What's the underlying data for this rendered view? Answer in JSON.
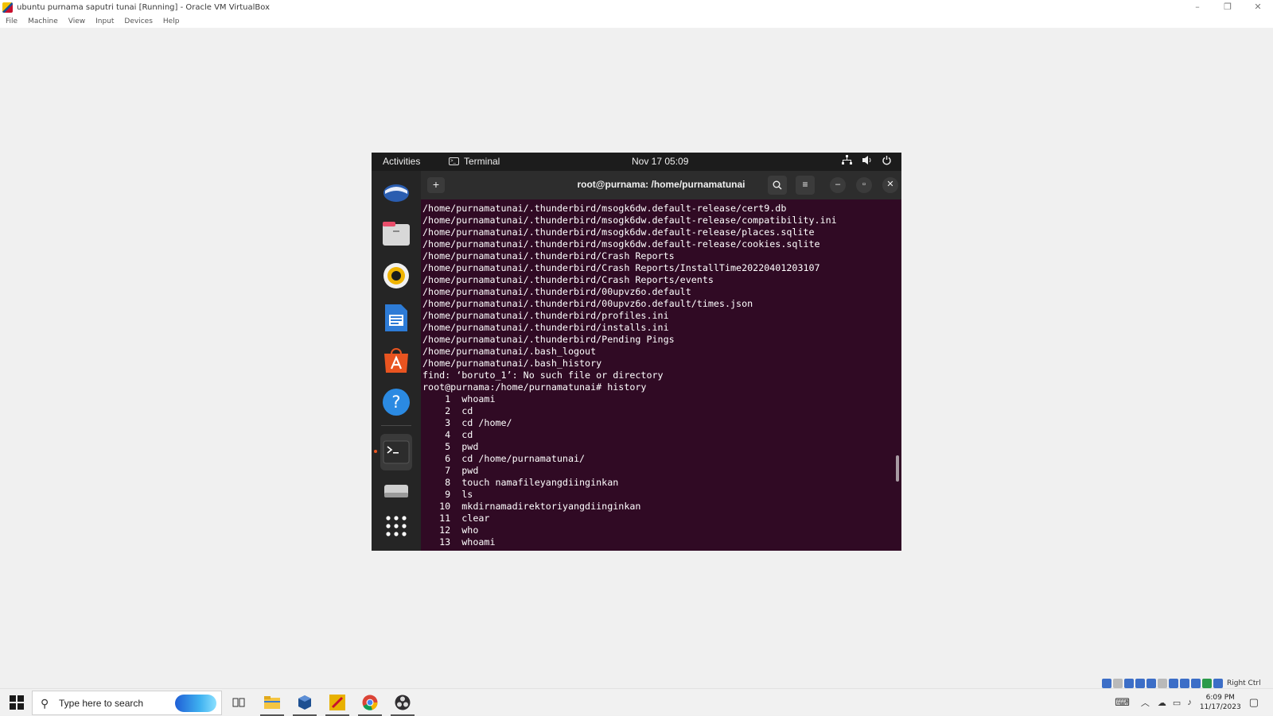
{
  "host": {
    "title": "ubuntu purnama saputri tunai [Running] - Oracle VM VirtualBox",
    "window_controls": {
      "minimize": "–",
      "restore": "❐",
      "close": "✕"
    },
    "menu": [
      "File",
      "Machine",
      "View",
      "Input",
      "Devices",
      "Help"
    ],
    "status_key": "Right Ctrl"
  },
  "guest": {
    "topbar": {
      "activities": "Activities",
      "app_name": "Terminal",
      "datetime": "Nov 17  05:09",
      "tray_icons": [
        "network-icon",
        "volume-icon",
        "power-icon"
      ]
    },
    "dock": [
      "thunderbird-icon",
      "files-icon",
      "rhythmbox-icon",
      "writer-icon",
      "software-icon",
      "help-icon",
      "terminal-icon",
      "drive-icon",
      "apps-grid-icon"
    ],
    "terminal": {
      "title": "root@purnama: /home/purnamatunai",
      "lines": [
        "/home/purnamatunai/.thunderbird/msogk6dw.default-release/cert9.db",
        "/home/purnamatunai/.thunderbird/msogk6dw.default-release/compatibility.ini",
        "/home/purnamatunai/.thunderbird/msogk6dw.default-release/places.sqlite",
        "/home/purnamatunai/.thunderbird/msogk6dw.default-release/cookies.sqlite",
        "/home/purnamatunai/.thunderbird/Crash Reports",
        "/home/purnamatunai/.thunderbird/Crash Reports/InstallTime20220401203107",
        "/home/purnamatunai/.thunderbird/Crash Reports/events",
        "/home/purnamatunai/.thunderbird/00upvz6o.default",
        "/home/purnamatunai/.thunderbird/00upvz6o.default/times.json",
        "/home/purnamatunai/.thunderbird/profiles.ini",
        "/home/purnamatunai/.thunderbird/installs.ini",
        "/home/purnamatunai/.thunderbird/Pending Pings",
        "/home/purnamatunai/.bash_logout",
        "/home/purnamatunai/.bash_history",
        "find: ‘boruto_1’: No such file or directory",
        "root@purnama:/home/purnamatunai# history",
        "    1  whoami",
        "    2  cd",
        "    3  cd /home/",
        "    4  cd",
        "    5  pwd",
        "    6  cd /home/purnamatunai/",
        "    7  pwd",
        "    8  touch namafileyangdiinginkan",
        "    9  ls",
        "   10  mkdirnamadirektoriyangdiinginkan",
        "   11  clear",
        "   12  who",
        "   13  whoami"
      ]
    }
  },
  "taskbar": {
    "search_placeholder": "Type here to search",
    "time": "6:09 PM",
    "date": "11/17/2023"
  }
}
